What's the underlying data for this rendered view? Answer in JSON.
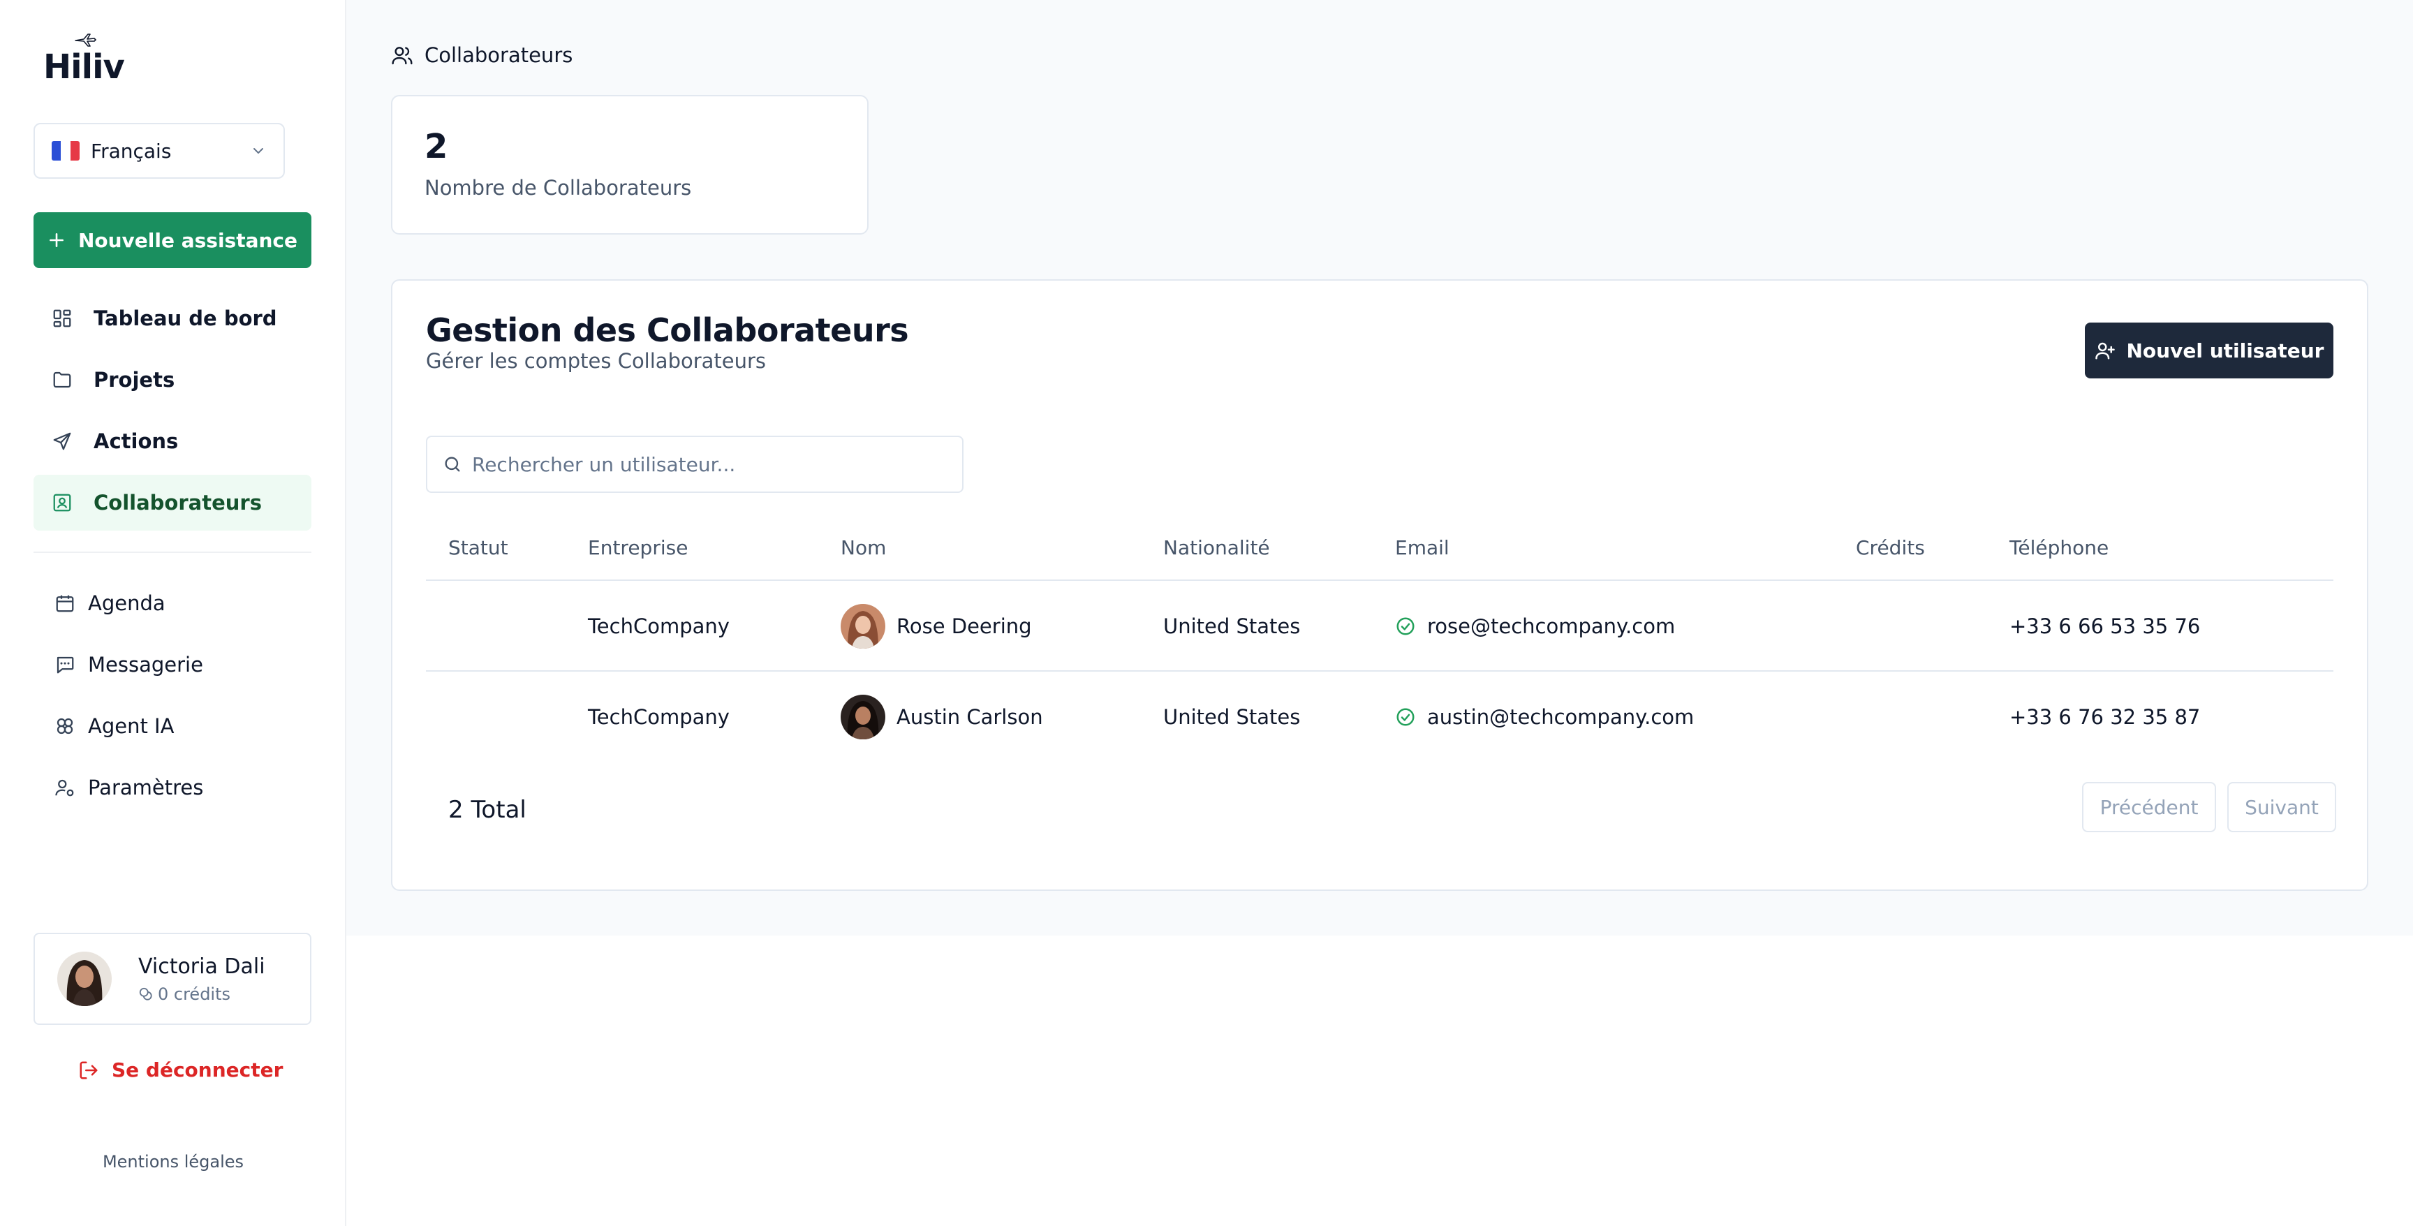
{
  "sidebar": {
    "logo_text": "Hiliv",
    "language": {
      "label": "Français",
      "flag": [
        "#2a4ed6",
        "#ffffff",
        "#e63946"
      ]
    },
    "new_button": "Nouvelle assistance",
    "nav_top": [
      {
        "label": "Tableau de bord",
        "icon": "dashboard-icon"
      },
      {
        "label": "Projets",
        "icon": "folder-icon"
      },
      {
        "label": "Actions",
        "icon": "send-icon"
      },
      {
        "label": "Collaborateurs",
        "icon": "contact-icon",
        "active": true
      }
    ],
    "nav_bottom": [
      {
        "label": "Agenda",
        "icon": "calendar-icon"
      },
      {
        "label": "Messagerie",
        "icon": "message-icon"
      },
      {
        "label": "Agent IA",
        "icon": "ai-icon"
      },
      {
        "label": "Paramètres",
        "icon": "user-settings-icon"
      }
    ],
    "user": {
      "name": "Victoria Dali",
      "credits": "0 crédits"
    },
    "logout": "Se déconnecter",
    "legal": "Mentions légales"
  },
  "header": {
    "breadcrumb": "Collaborateurs"
  },
  "stat": {
    "value": "2",
    "label": "Nombre de Collaborateurs"
  },
  "panel": {
    "title": "Gestion des Collaborateurs",
    "subtitle": "Gérer les comptes Collaborateurs",
    "new_user_button": "Nouvel utilisateur",
    "search_placeholder": "Rechercher un utilisateur..."
  },
  "table": {
    "columns": [
      "Statut",
      "Entreprise",
      "Nom",
      "Nationalité",
      "Email",
      "Crédits",
      "Téléphone"
    ],
    "rows": [
      {
        "status": "",
        "company": "TechCompany",
        "name": "Rose Deering",
        "nationality": "United States",
        "email": "rose@techcompany.com",
        "credits": "",
        "phone": "+33 6 66 53 35 76"
      },
      {
        "status": "",
        "company": "TechCompany",
        "name": "Austin Carlson",
        "nationality": "United States",
        "email": "austin@techcompany.com",
        "credits": "",
        "phone": "+33 6 76 32 35 87"
      }
    ]
  },
  "pagination": {
    "total": "2 Total",
    "prev": "Précédent",
    "next": "Suivant"
  },
  "colors": {
    "primary": "#1a8f5f",
    "dark": "#1e293b",
    "danger": "#dc2626",
    "active_bg": "#eefaf3",
    "check": "#22a05a"
  }
}
